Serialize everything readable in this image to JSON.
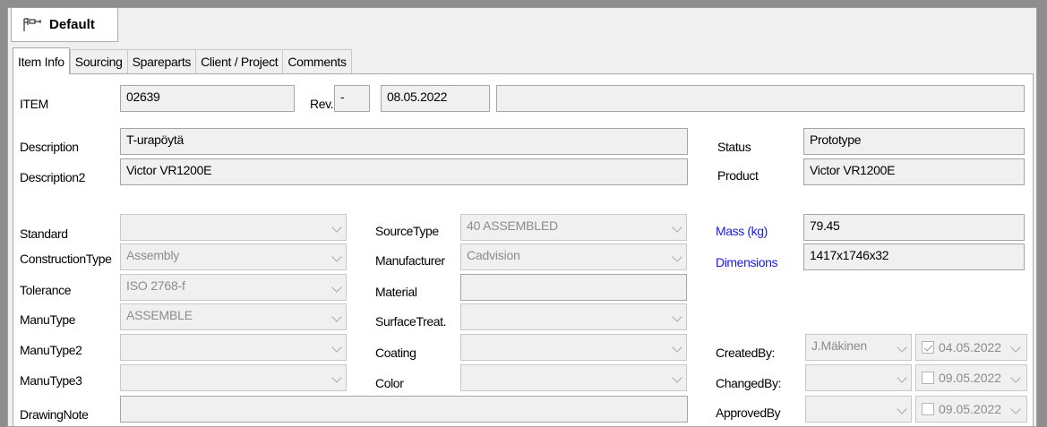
{
  "document_tab": {
    "label": "Default",
    "icon": "tree-structure-icon"
  },
  "tabs": [
    {
      "label": "Item Info",
      "active": true
    },
    {
      "label": "Sourcing"
    },
    {
      "label": "Spareparts"
    },
    {
      "label": "Client / Project"
    },
    {
      "label": "Comments"
    }
  ],
  "item": {
    "label": "ITEM",
    "number": "02639",
    "rev_label": "Rev.",
    "rev_value": "-",
    "date": "08.05.2022",
    "extra": ""
  },
  "description": {
    "label": "Description",
    "value": "T-urapöytä"
  },
  "description2": {
    "label": "Description2",
    "value": "Victor VR1200E"
  },
  "status": {
    "label": "Status",
    "value": "Prototype"
  },
  "product": {
    "label": "Product",
    "value": "Victor VR1200E"
  },
  "standard": {
    "label": "Standard",
    "value": ""
  },
  "construction_type": {
    "label": "ConstructionType",
    "value": "Assembly"
  },
  "tolerance": {
    "label": "Tolerance",
    "value": "ISO 2768-f"
  },
  "manu_type": {
    "label": "ManuType",
    "value": "ASSEMBLE"
  },
  "manu_type2": {
    "label": "ManuType2",
    "value": ""
  },
  "manu_type3": {
    "label": "ManuType3",
    "value": ""
  },
  "drawing_note": {
    "label": "DrawingNote",
    "value": ""
  },
  "source_type": {
    "label": "SourceType",
    "value": "40 ASSEMBLED"
  },
  "manufacturer": {
    "label": "Manufacturer",
    "value": "Cadvision"
  },
  "material": {
    "label": "Material",
    "value": ""
  },
  "surface_treat": {
    "label": "SurfaceTreat.",
    "value": ""
  },
  "coating": {
    "label": "Coating",
    "value": ""
  },
  "color": {
    "label": "Color",
    "value": ""
  },
  "mass": {
    "label": "Mass (kg)",
    "value": "79.45"
  },
  "dimensions": {
    "label": "Dimensions",
    "value": "1417x1746x32"
  },
  "created_by": {
    "label": "CreatedBy:",
    "user": "J.Mäkinen",
    "date": "04.05.2022",
    "checked": true
  },
  "changed_by": {
    "label": "ChangedBy:",
    "user": "",
    "date": "09.05.2022",
    "checked": false
  },
  "approved_by": {
    "label": "ApprovedBy",
    "user": "",
    "date": "09.05.2022",
    "checked": false
  },
  "colors": {
    "link_label": "#1a1ae6",
    "field_bg": "#f0f0f0",
    "panel_bg": "#ffffff"
  }
}
